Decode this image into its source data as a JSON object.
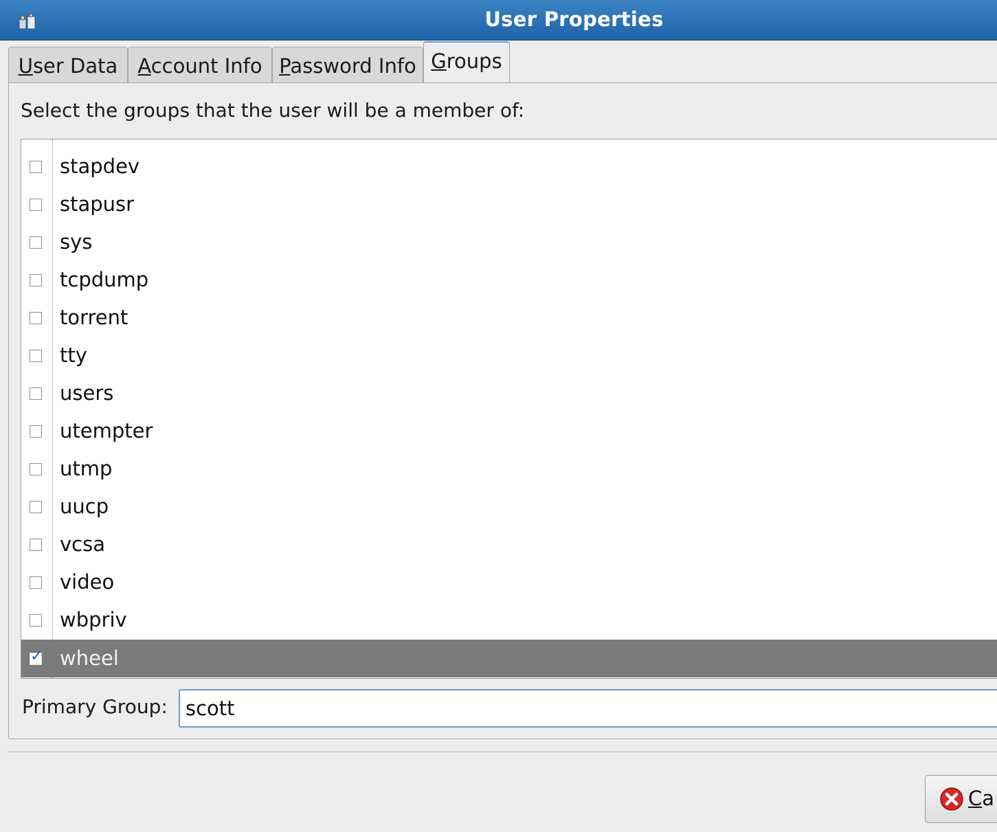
{
  "window": {
    "title": "User Properties",
    "app_icon": "users-icon"
  },
  "tabs": [
    {
      "label_ul": "U",
      "label_rest": "ser Data",
      "active": false
    },
    {
      "label_ul": "A",
      "label_rest": "ccount Info",
      "active": false
    },
    {
      "label_ul": "P",
      "label_rest": "assword Info",
      "active": false
    },
    {
      "label_ul": "G",
      "label_rest": "roups",
      "active": true
    }
  ],
  "groups_panel": {
    "instruction": "Select the groups that the user will be a member of:",
    "groups": [
      {
        "name": "stapdev",
        "checked": false
      },
      {
        "name": "stapusr",
        "checked": false
      },
      {
        "name": "sys",
        "checked": false
      },
      {
        "name": "tcpdump",
        "checked": false
      },
      {
        "name": "torrent",
        "checked": false
      },
      {
        "name": "tty",
        "checked": false
      },
      {
        "name": "users",
        "checked": false
      },
      {
        "name": "utempter",
        "checked": false
      },
      {
        "name": "utmp",
        "checked": false
      },
      {
        "name": "uucp",
        "checked": false
      },
      {
        "name": "vcsa",
        "checked": false
      },
      {
        "name": "video",
        "checked": false
      },
      {
        "name": "wbpriv",
        "checked": false
      },
      {
        "name": "wheel",
        "checked": true,
        "selected": true
      }
    ],
    "primary_group_label": "Primary Group:",
    "primary_group_value": "scott"
  },
  "buttons": {
    "cancel_ul": "C",
    "cancel_rest": "a"
  },
  "colors": {
    "titlebar": "#2f74b8",
    "selection": "#7b7b7b",
    "focus": "#6e9bd0",
    "cancel_icon": "#d42a2a"
  }
}
